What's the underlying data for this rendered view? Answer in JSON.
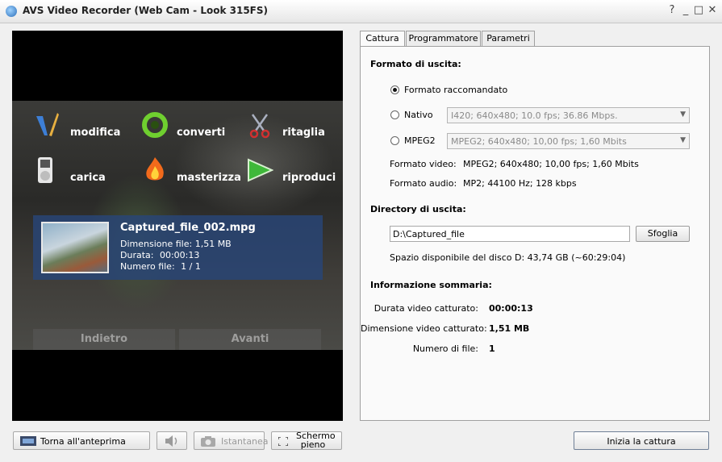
{
  "window": {
    "title": "AVS Video Recorder (Web Cam - Look 315FS)",
    "controls": [
      "?",
      "_",
      "□",
      "✕"
    ]
  },
  "video": {
    "menu": {
      "edit": "modifica",
      "convert": "converti",
      "trim": "ritaglia",
      "upload": "carica",
      "burn": "masterizza",
      "play": "riproduci"
    },
    "file": {
      "name": "Captured_file_002.mpg",
      "size_label": "Dimensione file:",
      "size_value": "1,51 MB",
      "duration_label": "Durata:",
      "duration_value": "00:00:13",
      "count_label": "Numero file:",
      "count_value": "1 / 1"
    },
    "back_label": "Indietro",
    "next_label": "Avanti"
  },
  "tabs": [
    "Cattura",
    "Programmatore",
    "Parametri"
  ],
  "output_format": {
    "heading": "Formato di uscita:",
    "recommended": "Formato raccomandato",
    "native": "Nativo",
    "native_value": "I420; 640x480; 10.0 fps; 36.86 Mbps.",
    "mpeg2": "MPEG2",
    "mpeg2_value": "MPEG2; 640x480; 10,00 fps; 1,60 Mbits",
    "video_label": "Formato video:",
    "video_value": "MPEG2; 640x480; 10,00 fps; 1,60 Mbits",
    "audio_label": "Formato audio:",
    "audio_value": "MP2; 44100 Hz; 128 kbps"
  },
  "output_dir": {
    "heading": "Directory di uscita:",
    "path": "D:\\Captured_file",
    "browse": "Sfoglia",
    "free_space": "Spazio disponibile del disco D: 43,74 GB (~60:29:04)"
  },
  "summary": {
    "heading": "Informazione sommaria:",
    "duration_label": "Durata video catturato:",
    "duration_value": "00:00:13",
    "size_label": "Dimensione video catturato:",
    "size_value": "1,51 MB",
    "count_label": "Numero di file:",
    "count_value": "1"
  },
  "bottom": {
    "back_preview": "Torna all'anteprima",
    "snapshot": "Istantanea",
    "fullscreen_line1": "Schermo",
    "fullscreen_line2": "pieno",
    "start_capture": "Inizia la cattura"
  }
}
